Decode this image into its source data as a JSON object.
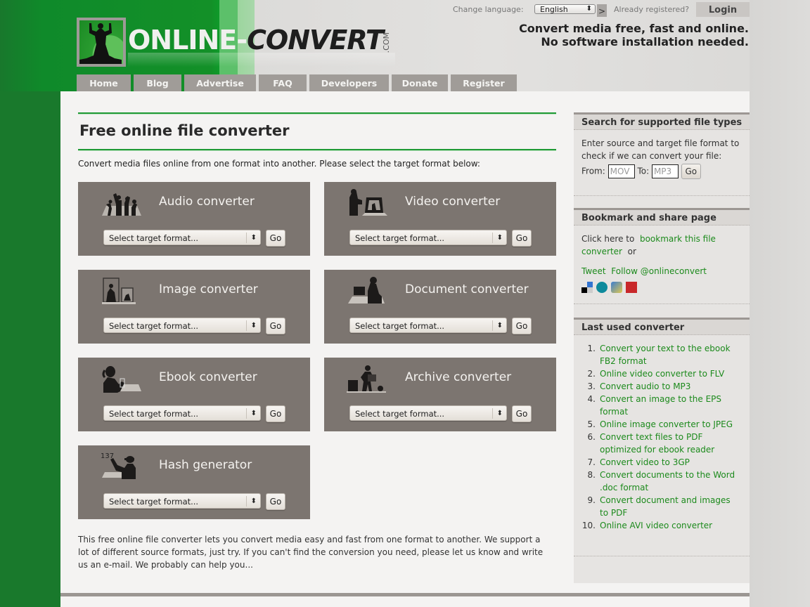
{
  "header": {
    "logo_text_part1": "ONLINE-",
    "logo_text_part2": "CONVERT",
    "logo_text_suffix": ".COM",
    "change_language_label": "Change language:",
    "language_selected": "English",
    "language_go": ">",
    "already_registered": "Already registered?",
    "login_label": "Login",
    "tagline_line1": "Convert media free, fast and online.",
    "tagline_line2": "No software installation needed."
  },
  "nav": {
    "items": [
      {
        "label": "Home"
      },
      {
        "label": "Blog"
      },
      {
        "label": "Advertise"
      },
      {
        "label": "FAQ"
      },
      {
        "label": "Developers"
      },
      {
        "label": "Donate"
      },
      {
        "label": "Register"
      }
    ]
  },
  "main": {
    "title": "Free online file converter",
    "intro": "Convert media files online from one format into another. Please select the target format below:",
    "select_placeholder": "Select target format...",
    "go_label": "Go",
    "converters": [
      {
        "title": "Audio converter",
        "icon": "dancing-people-icon"
      },
      {
        "title": "Video converter",
        "icon": "video-camera-person-icon"
      },
      {
        "title": "Image converter",
        "icon": "picture-frames-icon"
      },
      {
        "title": "Document converter",
        "icon": "person-at-computer-icon"
      },
      {
        "title": "Ebook converter",
        "icon": "person-reading-ebook-icon"
      },
      {
        "title": "Archive converter",
        "icon": "person-with-boxes-icon"
      },
      {
        "title": "Hash generator",
        "icon": "person-writing-hash-icon"
      }
    ],
    "outro": "This free online file converter lets you convert media      easy and fast from one format to another. We support a lot of different source formats, just try. If you can't find the conversion you need, please let us know and write us an e-mail. We probably can help you..."
  },
  "sidebar": {
    "search": {
      "title": "Search for supported file types",
      "description": "Enter source and target file format to check if we can convert your file:",
      "from_label": "From:",
      "from_placeholder": "MOV",
      "to_label": "To:",
      "to_placeholder": "MP3",
      "go_label": "Go"
    },
    "bookmark": {
      "title": "Bookmark and share page",
      "text_before": "Click here to",
      "link": "bookmark this file converter",
      "text_after": "or",
      "tweet": "Tweet",
      "follow": "Follow @onlineconvert",
      "share_icons": [
        "delicious-icon",
        "stumbleupon-icon",
        "myspace-icon",
        "share-icon"
      ]
    },
    "last_used": {
      "title": "Last used converter",
      "items": [
        {
          "num": "1.",
          "text": "Convert your text to the ebook FB2 format"
        },
        {
          "num": "2.",
          "text": "Online video converter to FLV"
        },
        {
          "num": "3.",
          "text": "Convert audio to MP3"
        },
        {
          "num": "4.",
          "text": "Convert an image to the EPS format"
        },
        {
          "num": "5.",
          "text": "Online image converter to JPEG"
        },
        {
          "num": "6.",
          "text": "Convert text files to PDF optimized for ebook reader"
        },
        {
          "num": "7.",
          "text": "Convert video to 3GP"
        },
        {
          "num": "8.",
          "text": "Convert documents to the Word .doc format"
        },
        {
          "num": "9.",
          "text": "Convert document and images to PDF"
        },
        {
          "num": "10.",
          "text": "Online AVI video converter"
        }
      ]
    }
  },
  "colors": {
    "brand_green": "#1f9a35",
    "link_green": "#1c8a1c",
    "card_bg": "#7c7570",
    "nav_bg": "#a09c98"
  }
}
